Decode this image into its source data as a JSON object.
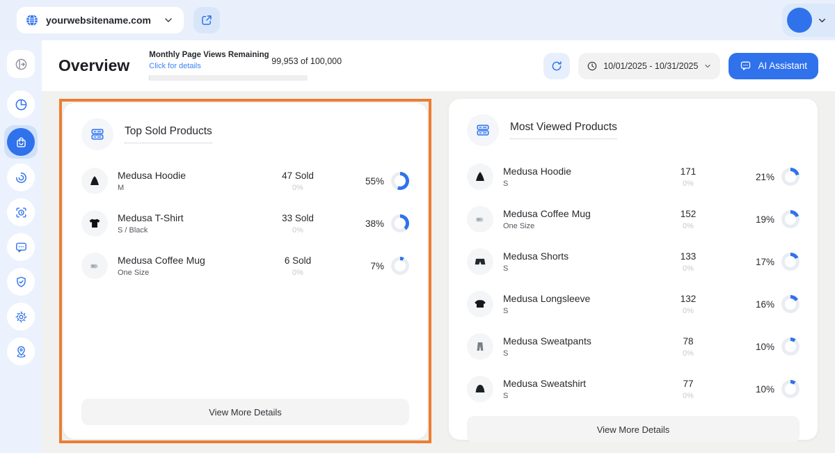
{
  "topbar": {
    "site_name": "yourwebsitename.com",
    "icons": [
      "globe-icon",
      "chevron-down-icon",
      "external-link-icon",
      "avatar",
      "chevron-down-icon"
    ]
  },
  "sidebar": {
    "active_index": 2,
    "items": [
      {
        "icon": "sidebar-toggle-icon"
      },
      {
        "icon": "pie-chart-icon"
      },
      {
        "icon": "shopping-bag-icon"
      },
      {
        "icon": "swirl-icon"
      },
      {
        "icon": "scan-clock-icon"
      },
      {
        "icon": "chat-bubble-icon"
      },
      {
        "icon": "shield-check-icon"
      },
      {
        "icon": "gear-icon"
      },
      {
        "icon": "map-pin-icon"
      }
    ]
  },
  "header": {
    "title": "Overview",
    "page_views_label": "Monthly Page Views Remaining",
    "page_views_link": "Click for details",
    "page_views_count": "99,953 of 100,000",
    "date_range": "10/01/2025 - 10/31/2025",
    "ai_button_label": "AI Assistant"
  },
  "colors": {
    "accent_blue": "#2F72EC",
    "donut_track": "#E9EDF3",
    "annotation_orange": "#ED7D31",
    "link_blue": "#3B82F6"
  },
  "chart_data": [
    {
      "type": "donut-list",
      "title": "Top Sold Products",
      "categories": [
        "Medusa Hoodie",
        "Medusa T-Shirt",
        "Medusa Coffee Mug"
      ],
      "values": [
        47,
        33,
        6
      ],
      "percents": [
        55,
        38,
        7
      ]
    },
    {
      "type": "donut-list",
      "title": "Most Viewed Products",
      "categories": [
        "Medusa Hoodie",
        "Medusa Coffee Mug",
        "Medusa Shorts",
        "Medusa Longsleeve",
        "Medusa Sweatpants",
        "Medusa Sweatshirt"
      ],
      "values": [
        171,
        152,
        133,
        132,
        78,
        77
      ],
      "percents": [
        21,
        19,
        17,
        16,
        10,
        10
      ]
    }
  ],
  "cards": [
    {
      "title": "Top Sold Products",
      "view_more": "View More Details",
      "rows": [
        {
          "name": "Medusa Hoodie",
          "variant": "M",
          "count": "47 Sold",
          "count_sub": "0%",
          "percent": "55%",
          "percent_value": 55,
          "image": "hoodie-image"
        },
        {
          "name": "Medusa T-Shirt",
          "variant": "S / Black",
          "count": "33 Sold",
          "count_sub": "0%",
          "percent": "38%",
          "percent_value": 38,
          "image": "tshirt-image"
        },
        {
          "name": "Medusa Coffee Mug",
          "variant": "One Size",
          "count": "6 Sold",
          "count_sub": "0%",
          "percent": "7%",
          "percent_value": 7,
          "image": "coffee-mug-image"
        }
      ]
    },
    {
      "title": "Most Viewed Products",
      "view_more": "View More Details",
      "rows": [
        {
          "name": "Medusa Hoodie",
          "variant": "S",
          "count": "171",
          "count_sub": "0%",
          "percent": "21%",
          "percent_value": 21,
          "image": "hoodie-image"
        },
        {
          "name": "Medusa Coffee Mug",
          "variant": "One Size",
          "count": "152",
          "count_sub": "0%",
          "percent": "19%",
          "percent_value": 19,
          "image": "coffee-mug-image"
        },
        {
          "name": "Medusa Shorts",
          "variant": "S",
          "count": "133",
          "count_sub": "0%",
          "percent": "17%",
          "percent_value": 17,
          "image": "shorts-image"
        },
        {
          "name": "Medusa Longsleeve",
          "variant": "S",
          "count": "132",
          "count_sub": "0%",
          "percent": "16%",
          "percent_value": 16,
          "image": "longsleeve-image"
        },
        {
          "name": "Medusa Sweatpants",
          "variant": "S",
          "count": "78",
          "count_sub": "0%",
          "percent": "10%",
          "percent_value": 10,
          "image": "sweatpants-image"
        },
        {
          "name": "Medusa Sweatshirt",
          "variant": "S",
          "count": "77",
          "count_sub": "0%",
          "percent": "10%",
          "percent_value": 10,
          "image": "sweatshirt-image"
        }
      ]
    }
  ]
}
